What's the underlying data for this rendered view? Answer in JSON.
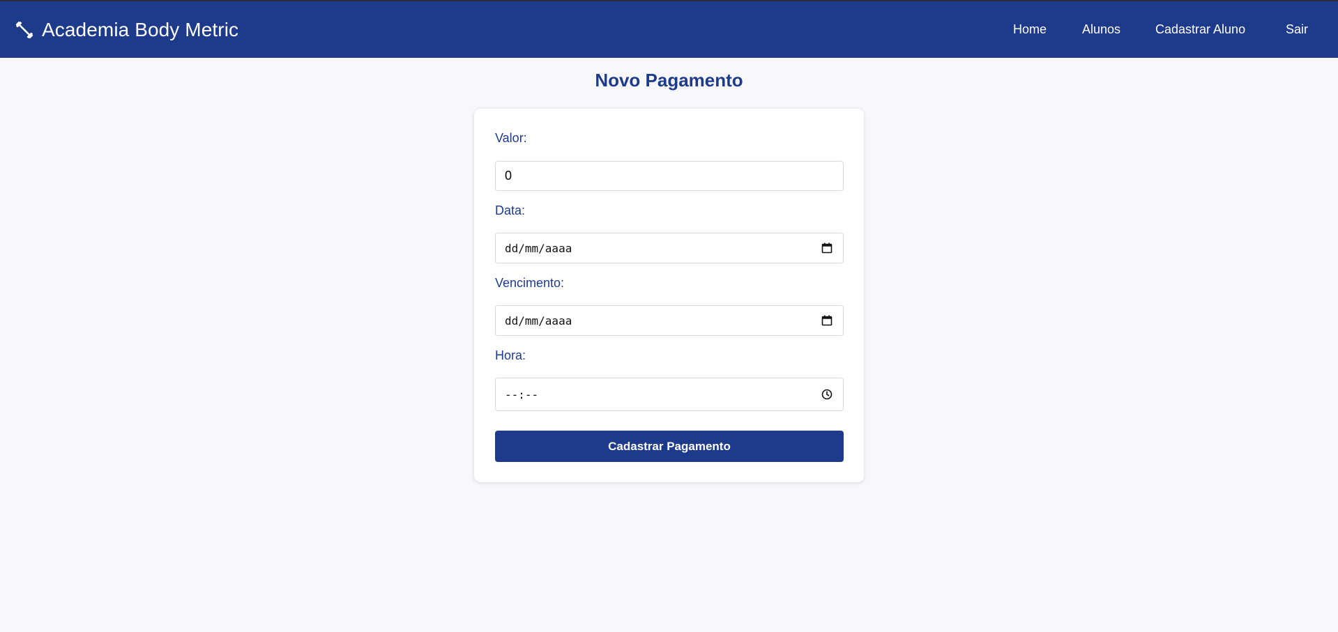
{
  "navbar": {
    "brand_icon": "dumbbell-icon",
    "brand_title": "Academia Body Metric",
    "links": {
      "home": "Home",
      "alunos": "Alunos",
      "cadastrar_aluno": "Cadastrar Aluno",
      "sair": "Sair"
    },
    "background_color": "#1e3a8a"
  },
  "page": {
    "title": "Novo Pagamento",
    "background_color": "#f8f8fc"
  },
  "form": {
    "valor": {
      "label": "Valor:",
      "value": "0"
    },
    "data": {
      "label": "Data:",
      "placeholder": "dd/mm/aaaa",
      "icon": "calendar-icon"
    },
    "vencimento": {
      "label": "Vencimento:",
      "placeholder": "dd/mm/aaaa",
      "icon": "calendar-icon"
    },
    "hora": {
      "label": "Hora:",
      "placeholder": "--:--",
      "icon": "clock-icon"
    },
    "submit_label": "Cadastrar Pagamento",
    "accent_color": "#1e3a8a"
  }
}
